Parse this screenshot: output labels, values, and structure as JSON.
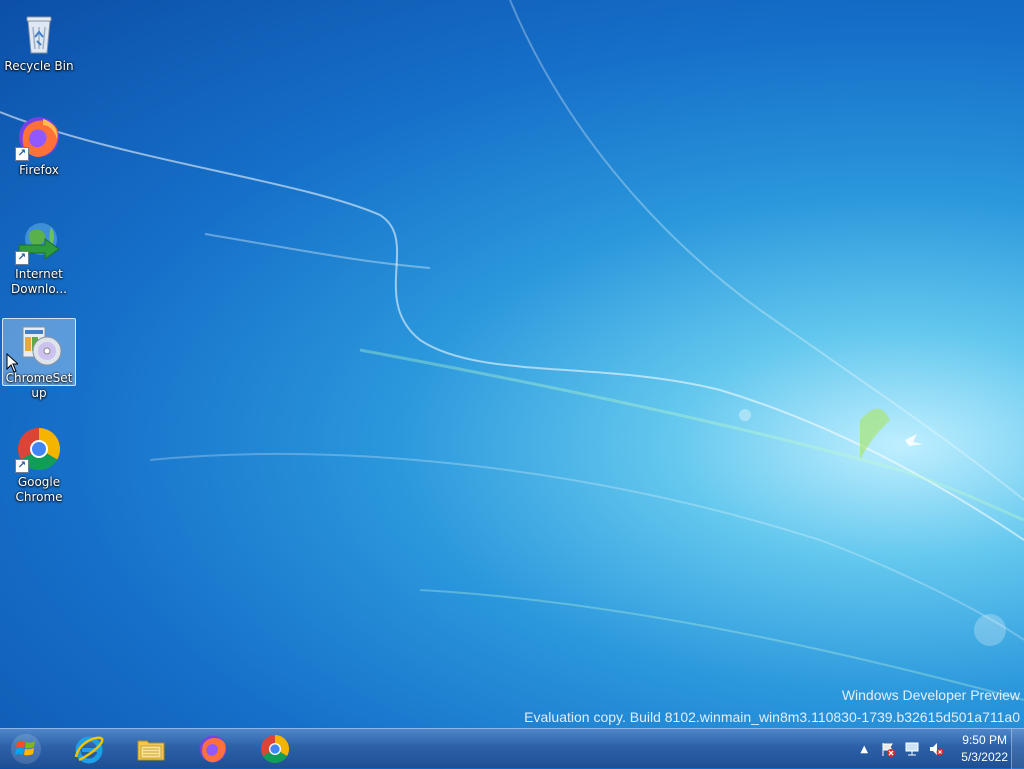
{
  "desktop_icons": [
    {
      "label": "Recycle Bin",
      "icon": "recycle-bin-icon",
      "shortcut": false,
      "selected": false
    },
    {
      "label": "Firefox",
      "icon": "firefox-icon",
      "shortcut": true,
      "selected": false
    },
    {
      "label": "Internet Downlo...",
      "icon": "internet-download-manager-icon",
      "shortcut": true,
      "selected": false
    },
    {
      "label": "ChromeSetup",
      "icon": "setup-installer-icon",
      "shortcut": false,
      "selected": true
    },
    {
      "label": "Google Chrome",
      "icon": "chrome-icon",
      "shortcut": true,
      "selected": false
    }
  ],
  "watermark": {
    "line1": "Windows Developer Preview",
    "line2": "Evaluation copy. Build 8102.winmain_win8m3.110830-1739.b32615d501a711a0"
  },
  "taskbar": {
    "start_icon": "windows-logo-icon",
    "pinned": [
      "internet-explorer-icon",
      "file-explorer-icon",
      "firefox-icon",
      "chrome-icon"
    ],
    "tray": {
      "icons": [
        "show-hidden-icons-chevron",
        "action-center-flag-icon",
        "network-icon",
        "volume-muted-icon"
      ],
      "time": "9:50 PM",
      "date": "5/3/2022"
    }
  },
  "colors": {
    "taskbar": "#2c61a8",
    "wallpaper_main": "#1670c9",
    "selection": "#b4d2f5"
  }
}
